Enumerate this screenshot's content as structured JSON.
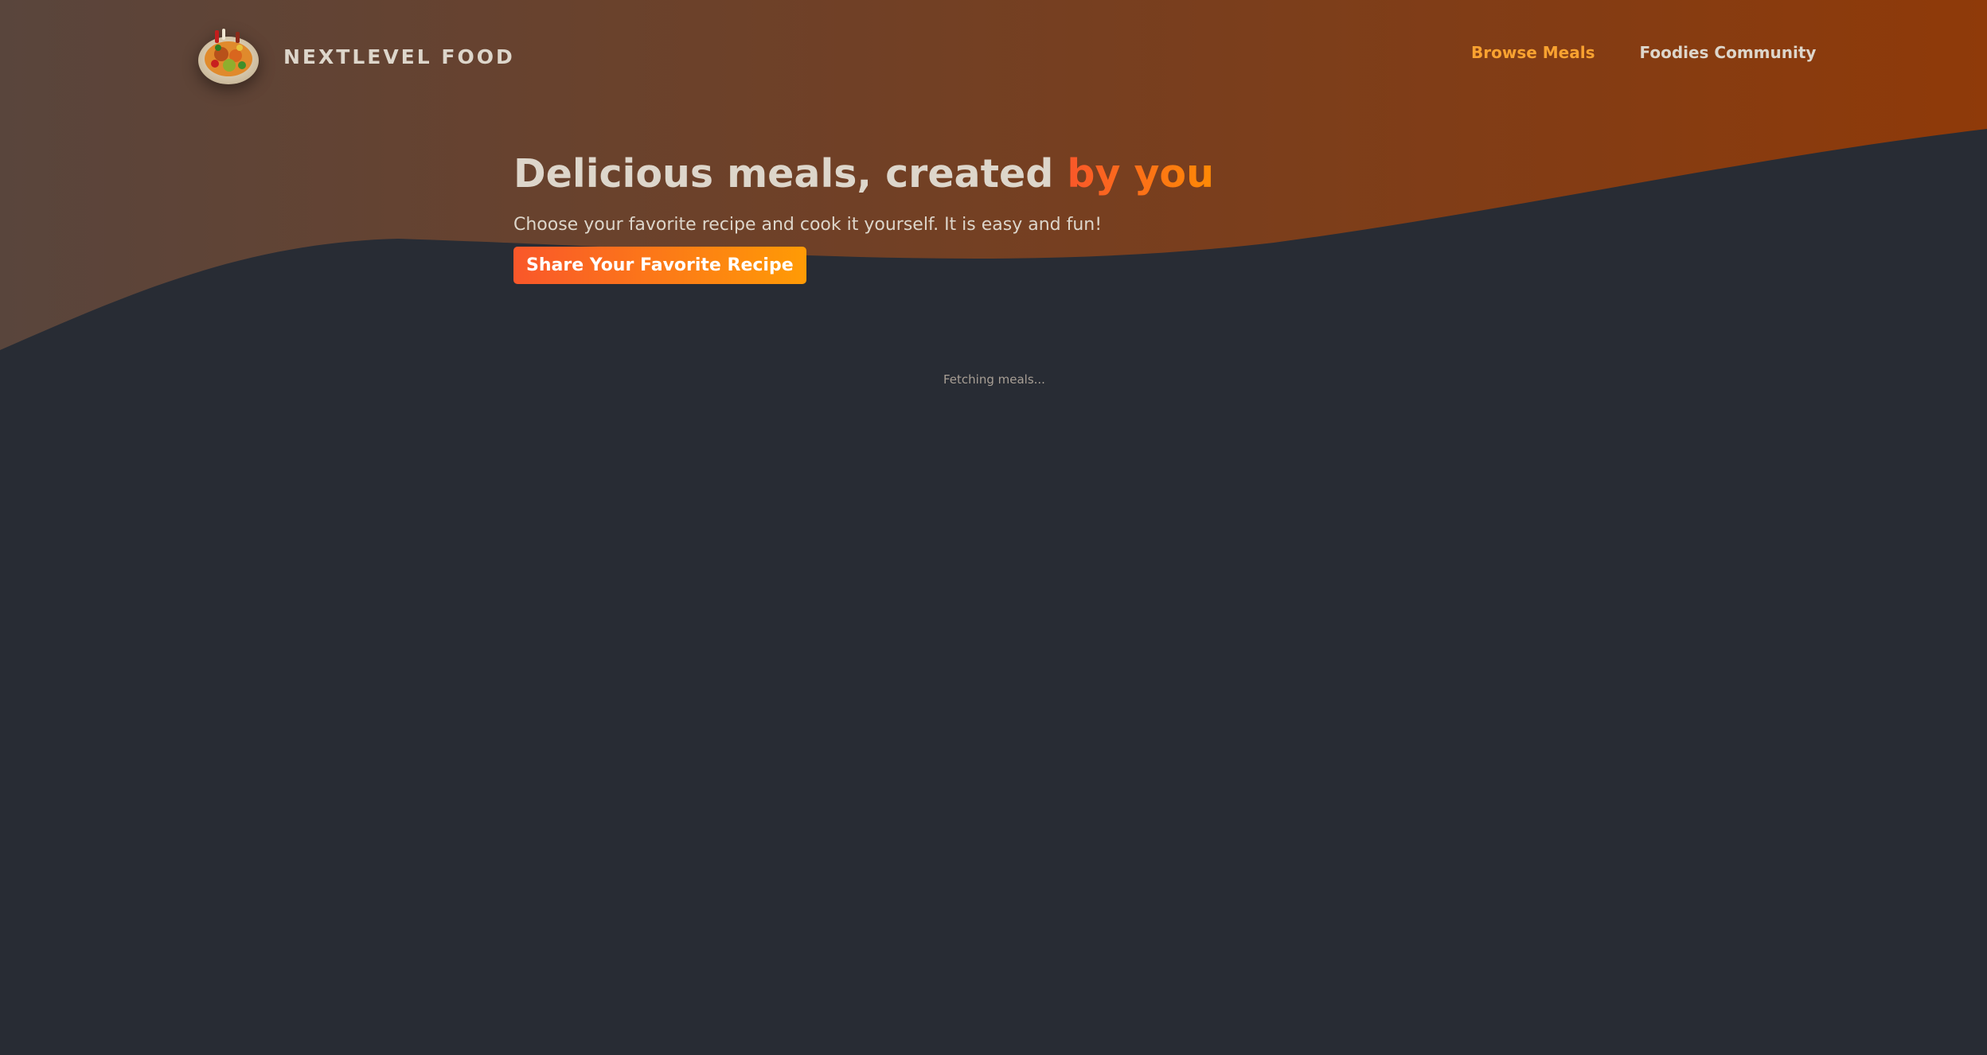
{
  "header": {
    "logo_text": "NEXTLEVEL FOOD",
    "logo_icon": "food-platter-logo",
    "nav": {
      "browse_meals": "Browse Meals",
      "foodies_community": "Foodies Community"
    }
  },
  "hero": {
    "title_main": "Delicious meals, created ",
    "title_highlight": "by you",
    "subtitle": "Choose your favorite recipe and cook it yourself. It is easy and fun!",
    "cta_label": "Share Your Favorite Recipe"
  },
  "status": {
    "loading_text": "Fetching meals..."
  },
  "colors": {
    "background": "#282c34",
    "hero_gradient_start": "#59453c",
    "hero_gradient_end": "#8a3a0a",
    "accent": "#f9a230",
    "highlight_start": "#f9572a",
    "highlight_end": "#ff8a05",
    "text": "#ddd6cb"
  }
}
